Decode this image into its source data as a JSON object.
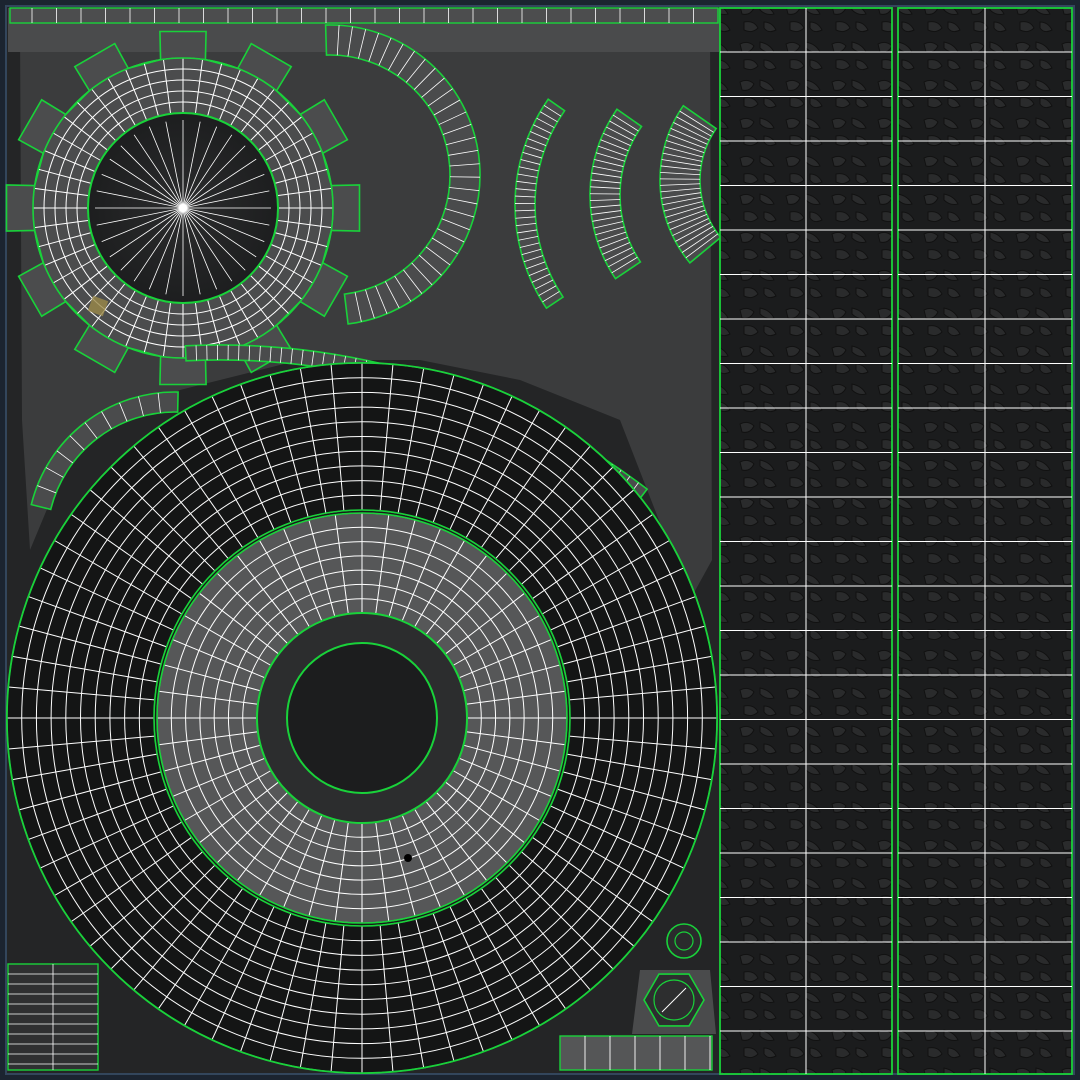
{
  "editor": {
    "view": "UV layout",
    "grid": true
  },
  "colors": {
    "frame": "#2a3a4c",
    "background": "#222425",
    "island_fill": "#3a3b3c",
    "island_fill_light": "#565758",
    "tread_fill": "#1d1e1f",
    "seam": "#19d23a",
    "wire": "#ffffff",
    "selected_face": "#9b8a4a"
  },
  "icons": {
    "wheel_hub_island": "gear-icon",
    "tire_island": "tire-icon",
    "bolt_island": "hexagon-icon"
  }
}
